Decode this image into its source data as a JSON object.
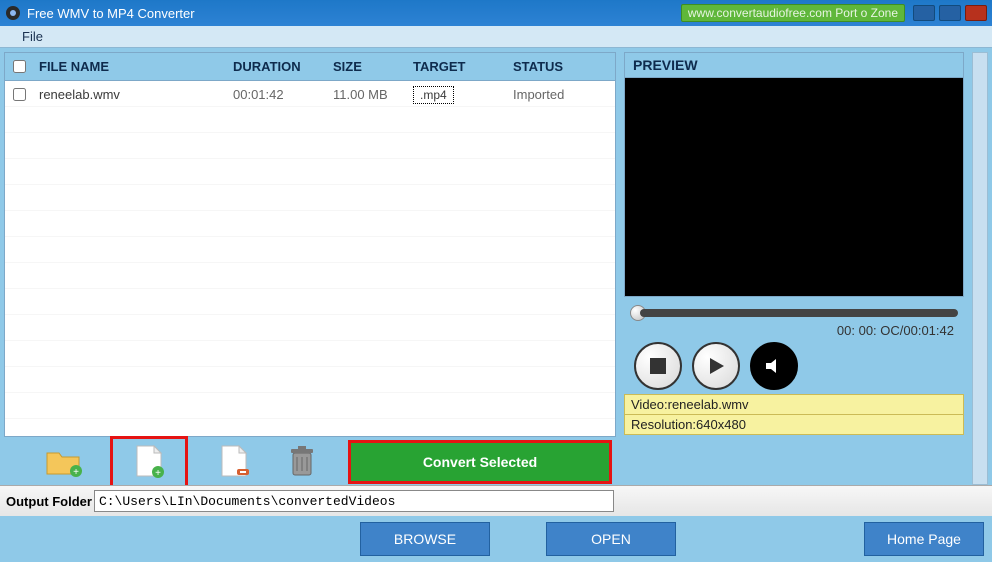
{
  "window": {
    "title": "Free WMV to MP4 Converter",
    "banner": "www.convertaudiofree.com Port o Zone"
  },
  "menu": {
    "file": "File"
  },
  "table": {
    "headers": {
      "filename": "FILE NAME",
      "duration": "DURATION",
      "size": "SIZE",
      "target": "TARGET",
      "status": "STATUS"
    },
    "rows": [
      {
        "checked": false,
        "filename": "reneelab.wmv",
        "duration": "00:01:42",
        "size": "11.00 MB",
        "target": ".mp4",
        "status": "Imported"
      }
    ]
  },
  "toolbar": {
    "convert_label": "Convert Selected"
  },
  "preview": {
    "title": "PREVIEW",
    "time": "00: 00: OC/00:01:42",
    "video_label": "Video:reneelab.wmv",
    "resolution_label": "Resolution:640x480"
  },
  "output": {
    "label": "Output Folder",
    "path": "C:\\Users\\LIn\\Documents\\convertedVideos"
  },
  "buttons": {
    "browse": "BROWSE",
    "open": "OPEN",
    "homepage": "Home Page"
  }
}
